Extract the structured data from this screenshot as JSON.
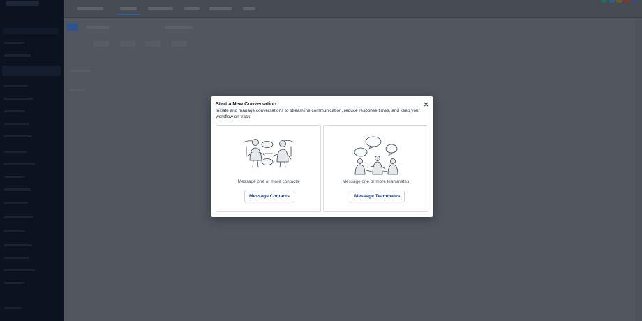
{
  "modal": {
    "title": "Start a New Conversation",
    "description": "Initiate and manage conversations to streamline communication, reduce response times, and keep your workflow on track.",
    "close_icon": "close-icon",
    "cards": {
      "contacts": {
        "illustration": "two-people-talking-illustration",
        "text": "Message one or more contacts",
        "button_label": "Message Contacts"
      },
      "teammates": {
        "illustration": "team-discussion-illustration",
        "text": "Message one or more teammates",
        "button_label": "Message Teammates"
      }
    }
  },
  "colors": {
    "overlay": "#525761",
    "sidebar": "#0b1220",
    "modal_bg": "#ffffff",
    "button_text": "#1e3a8a",
    "title_text": "#111827",
    "card_text": "#4b5563"
  }
}
